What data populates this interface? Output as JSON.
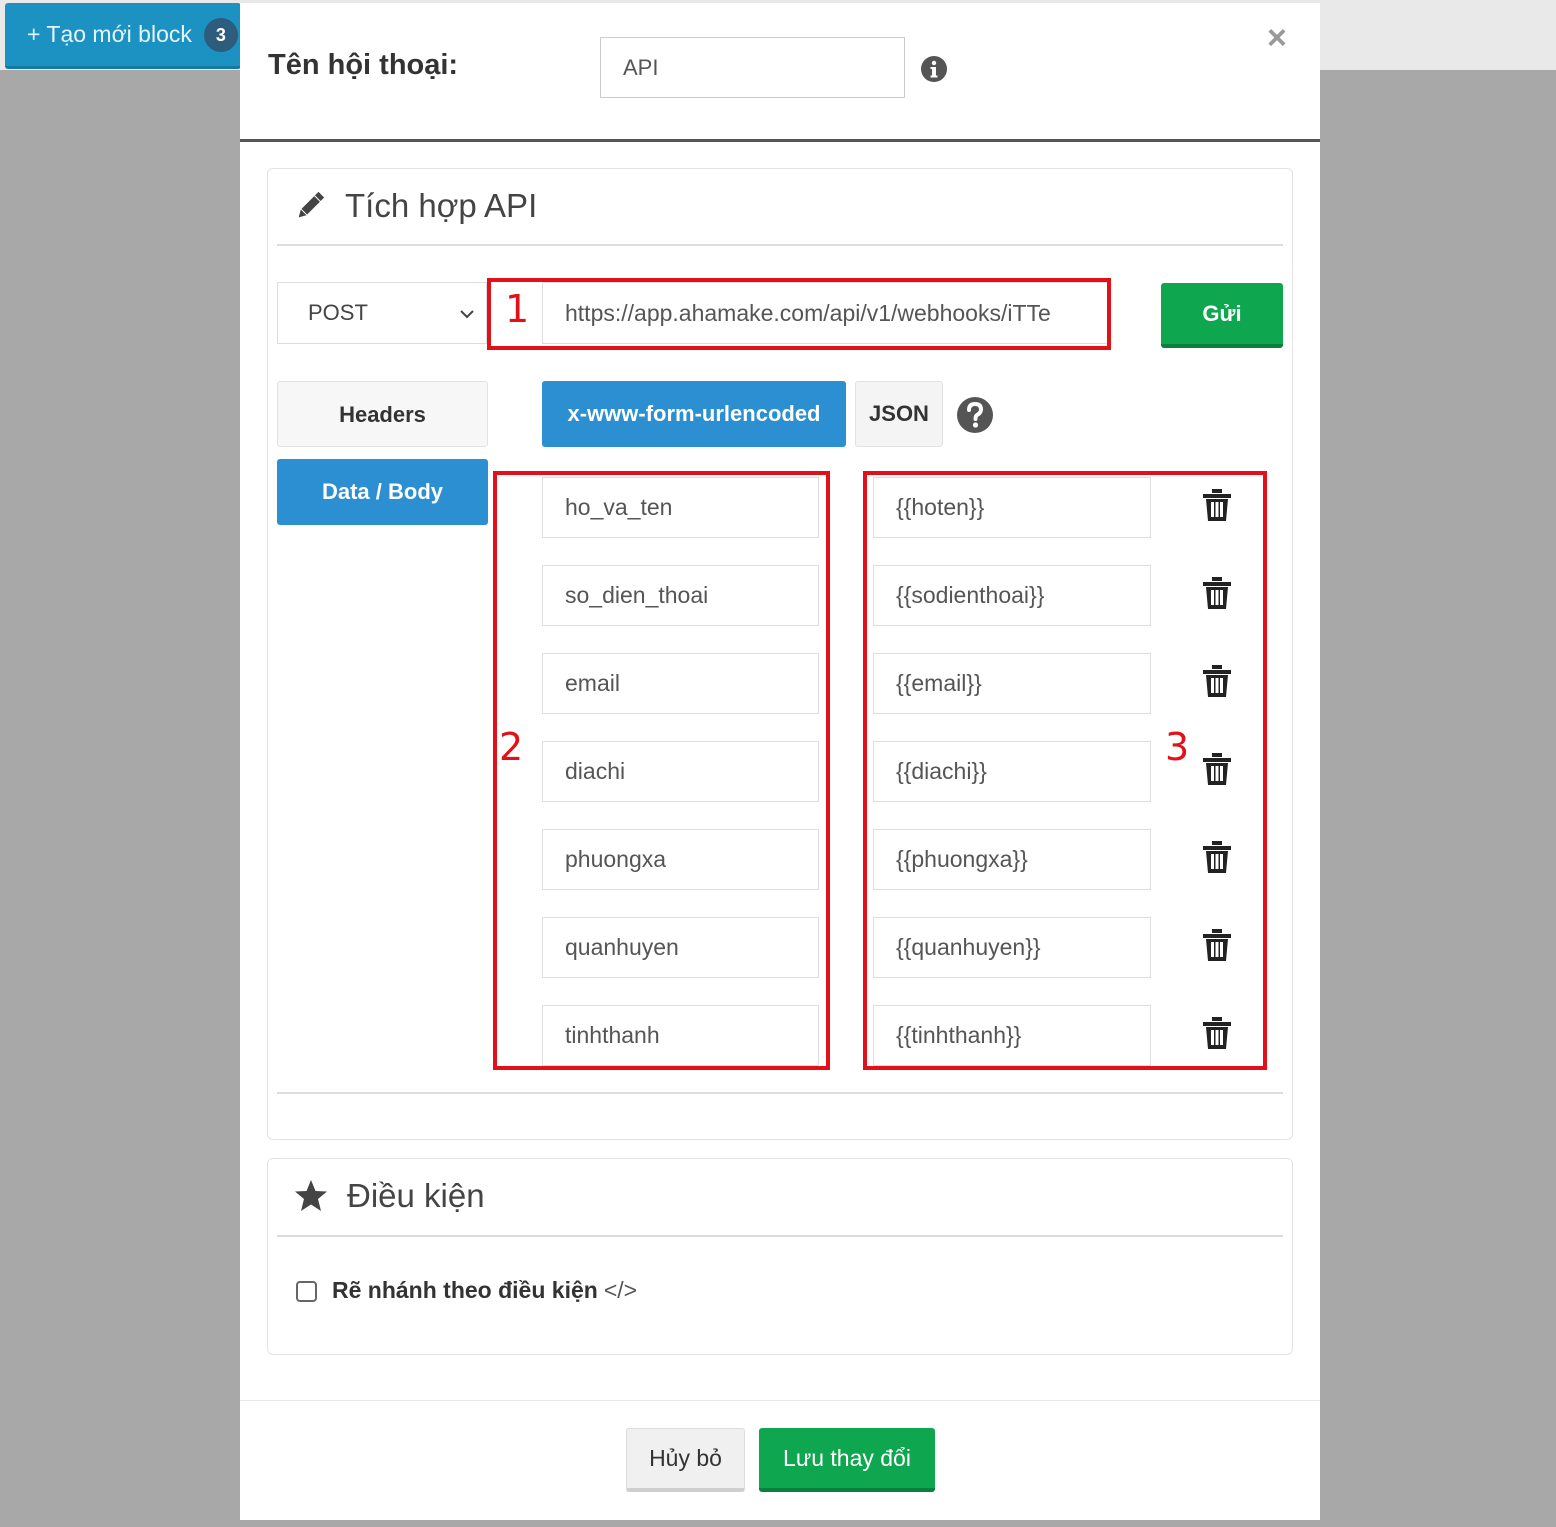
{
  "background": {
    "create_block_label": "+ Tạo mới block",
    "create_block_count": "3"
  },
  "modal": {
    "title_label": "Tên hội thoại:",
    "title_value": "API",
    "close_symbol": "×"
  },
  "api_panel": {
    "title": "Tích hợp API",
    "method": "POST",
    "url": "https://app.ahamake.com/api/v1/webhooks/iTTe",
    "send_label": "Gửi",
    "tabs": {
      "headers": "Headers",
      "body": "Data / Body"
    },
    "encoding": {
      "form": "x-www-form-urlencoded",
      "json": "JSON"
    },
    "fields": [
      {
        "key": "ho_va_ten",
        "value": "{{hoten}}"
      },
      {
        "key": "so_dien_thoai",
        "value": "{{sodienthoai}}"
      },
      {
        "key": "email",
        "value": "{{email}}"
      },
      {
        "key": "diachi",
        "value": "{{diachi}}"
      },
      {
        "key": "phuongxa",
        "value": "{{phuongxa}}"
      },
      {
        "key": "quanhuyen",
        "value": "{{quanhuyen}}"
      },
      {
        "key": "tinhthanh",
        "value": "{{tinhthanh}}"
      }
    ],
    "annotations": [
      "1",
      "2",
      "3"
    ]
  },
  "condition_panel": {
    "title": "Điều kiện",
    "checkbox_label": "Rẽ nhánh theo điều kiện",
    "code_symbol": "</>"
  },
  "footer": {
    "cancel_label": "Hủy bỏ",
    "save_label": "Lưu thay đổi"
  },
  "colors": {
    "primary_blue": "#2b8fd1",
    "success_green": "#0ea64f",
    "annotation_red": "#e3101a"
  }
}
